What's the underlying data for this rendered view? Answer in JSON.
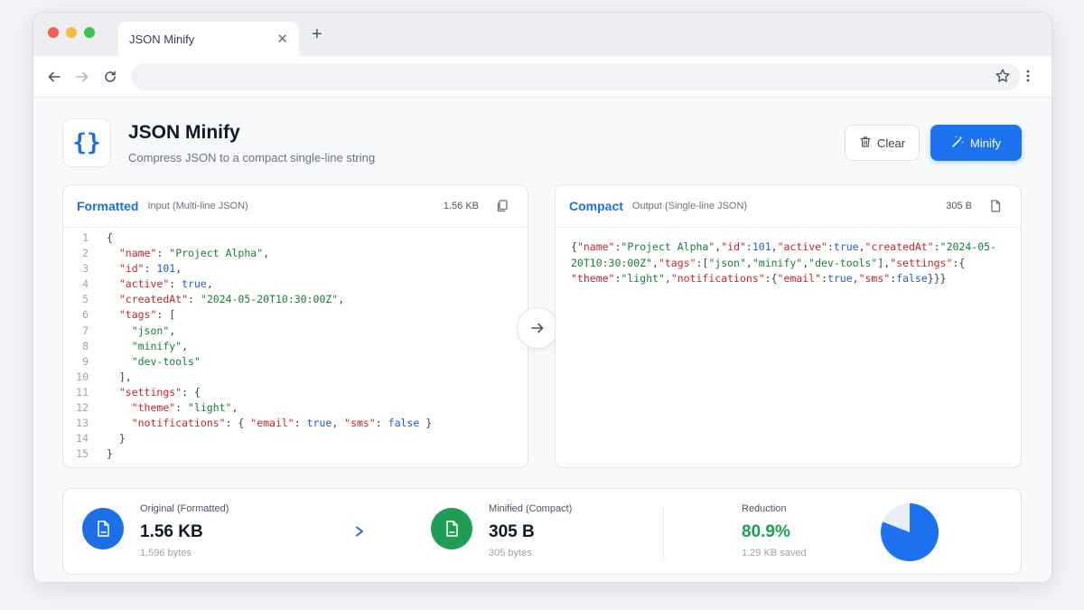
{
  "browser": {
    "tab_title": "JSON Minify",
    "close_glyph": "✕",
    "new_tab_glyph": "+"
  },
  "header": {
    "icon_text": "{}",
    "title": "JSON Minify",
    "subtitle": "Compress JSON to a compact single-line string",
    "clear_label": "Clear",
    "minify_label": "Minify"
  },
  "input_panel": {
    "name": "Formatted",
    "description": "Input (Multi-line JSON)",
    "size": "1.56 KB",
    "lines": [
      {
        "no": "1",
        "tokens": [
          {
            "t": "p",
            "v": "{"
          }
        ]
      },
      {
        "no": "2",
        "tokens": [
          {
            "t": "p",
            "v": "  "
          },
          {
            "t": "k",
            "v": "\"name\""
          },
          {
            "t": "p",
            "v": ": "
          },
          {
            "t": "s",
            "v": "\"Project Alpha\""
          },
          {
            "t": "p",
            "v": ","
          }
        ]
      },
      {
        "no": "3",
        "tokens": [
          {
            "t": "p",
            "v": "  "
          },
          {
            "t": "k",
            "v": "\"id\""
          },
          {
            "t": "p",
            "v": ": "
          },
          {
            "t": "n",
            "v": "101"
          },
          {
            "t": "p",
            "v": ","
          }
        ]
      },
      {
        "no": "4",
        "tokens": [
          {
            "t": "p",
            "v": "  "
          },
          {
            "t": "k",
            "v": "\"active\""
          },
          {
            "t": "p",
            "v": ": "
          },
          {
            "t": "b",
            "v": "true"
          },
          {
            "t": "p",
            "v": ","
          }
        ]
      },
      {
        "no": "5",
        "tokens": [
          {
            "t": "p",
            "v": "  "
          },
          {
            "t": "k",
            "v": "\"createdAt\""
          },
          {
            "t": "p",
            "v": ": "
          },
          {
            "t": "s",
            "v": "\"2024-05-20T10:30:00Z\""
          },
          {
            "t": "p",
            "v": ","
          }
        ]
      },
      {
        "no": "6",
        "tokens": [
          {
            "t": "p",
            "v": "  "
          },
          {
            "t": "k",
            "v": "\"tags\""
          },
          {
            "t": "p",
            "v": ": ["
          }
        ]
      },
      {
        "no": "7",
        "tokens": [
          {
            "t": "p",
            "v": "    "
          },
          {
            "t": "s",
            "v": "\"json\""
          },
          {
            "t": "p",
            "v": ","
          }
        ]
      },
      {
        "no": "8",
        "tokens": [
          {
            "t": "p",
            "v": "    "
          },
          {
            "t": "s",
            "v": "\"minify\""
          },
          {
            "t": "p",
            "v": ","
          }
        ]
      },
      {
        "no": "9",
        "tokens": [
          {
            "t": "p",
            "v": "    "
          },
          {
            "t": "s",
            "v": "\"dev-tools\""
          }
        ]
      },
      {
        "no": "10",
        "tokens": [
          {
            "t": "p",
            "v": "  ],"
          }
        ]
      },
      {
        "no": "11",
        "tokens": [
          {
            "t": "p",
            "v": "  "
          },
          {
            "t": "k",
            "v": "\"settings\""
          },
          {
            "t": "p",
            "v": ": {"
          }
        ]
      },
      {
        "no": "12",
        "tokens": [
          {
            "t": "p",
            "v": "    "
          },
          {
            "t": "k",
            "v": "\"theme\""
          },
          {
            "t": "p",
            "v": ": "
          },
          {
            "t": "s",
            "v": "\"light\""
          },
          {
            "t": "p",
            "v": ","
          }
        ]
      },
      {
        "no": "13",
        "tokens": [
          {
            "t": "p",
            "v": "    "
          },
          {
            "t": "k",
            "v": "\"notifications\""
          },
          {
            "t": "p",
            "v": ": { "
          },
          {
            "t": "k",
            "v": "\"email\""
          },
          {
            "t": "p",
            "v": ": "
          },
          {
            "t": "b",
            "v": "true"
          },
          {
            "t": "p",
            "v": ", "
          },
          {
            "t": "k",
            "v": "\"sms\""
          },
          {
            "t": "p",
            "v": ": "
          },
          {
            "t": "b",
            "v": "false"
          },
          {
            "t": "p",
            "v": " }"
          }
        ]
      },
      {
        "no": "14",
        "tokens": [
          {
            "t": "p",
            "v": "  }"
          }
        ]
      },
      {
        "no": "15",
        "tokens": [
          {
            "t": "p",
            "v": "}"
          }
        ]
      }
    ]
  },
  "output_panel": {
    "name": "Compact",
    "description": "Output (Single-line JSON)",
    "size": "305 B",
    "lines": [
      [
        {
          "t": "p",
          "v": "{"
        },
        {
          "t": "k",
          "v": "\"name\""
        },
        {
          "t": "p",
          "v": ":"
        },
        {
          "t": "s",
          "v": "\"Project Alpha\""
        },
        {
          "t": "p",
          "v": ","
        },
        {
          "t": "k",
          "v": "\"id\""
        },
        {
          "t": "p",
          "v": ":"
        },
        {
          "t": "n",
          "v": "101"
        },
        {
          "t": "p",
          "v": ","
        },
        {
          "t": "k",
          "v": "\"active\""
        },
        {
          "t": "p",
          "v": ":"
        },
        {
          "t": "b",
          "v": "true"
        },
        {
          "t": "p",
          "v": ","
        },
        {
          "t": "k",
          "v": "\"createdAt\""
        },
        {
          "t": "p",
          "v": ":"
        },
        {
          "t": "s",
          "v": "\"2024-05-"
        }
      ],
      [
        {
          "t": "s",
          "v": "20T10:30:00Z\""
        },
        {
          "t": "p",
          "v": ","
        },
        {
          "t": "k",
          "v": "\"tags\""
        },
        {
          "t": "p",
          "v": ":["
        },
        {
          "t": "s",
          "v": "\"json\""
        },
        {
          "t": "p",
          "v": ","
        },
        {
          "t": "s",
          "v": "\"minify\""
        },
        {
          "t": "p",
          "v": ","
        },
        {
          "t": "s",
          "v": "\"dev-tools\""
        },
        {
          "t": "p",
          "v": "],"
        },
        {
          "t": "k",
          "v": "\"settings\""
        },
        {
          "t": "p",
          "v": ":{"
        }
      ],
      [
        {
          "t": "k",
          "v": "\"theme\""
        },
        {
          "t": "p",
          "v": ":"
        },
        {
          "t": "s",
          "v": "\"light\""
        },
        {
          "t": "p",
          "v": ","
        },
        {
          "t": "k",
          "v": "\"notifications\""
        },
        {
          "t": "p",
          "v": ":{"
        },
        {
          "t": "k",
          "v": "\"email\""
        },
        {
          "t": "p",
          "v": ":"
        },
        {
          "t": "b",
          "v": "true"
        },
        {
          "t": "p",
          "v": ","
        },
        {
          "t": "k",
          "v": "\"sms\""
        },
        {
          "t": "p",
          "v": ":"
        },
        {
          "t": "b",
          "v": "false"
        },
        {
          "t": "p",
          "v": "}}}"
        }
      ]
    ]
  },
  "stats": {
    "original": {
      "label": "Original (Formatted)",
      "value": "1.56 KB",
      "sub": "1,596 bytes"
    },
    "minified": {
      "label": "Minified (Compact)",
      "value": "305 B",
      "sub": "305 bytes"
    },
    "reduction": {
      "label": "Reduction",
      "value": "80.9%",
      "sub": "1.29 KB saved",
      "fraction": 0.809
    }
  },
  "colors": {
    "accent": "#1d72f0",
    "key": "#c0262d",
    "string": "#177d3c",
    "number": "#1c5fcf",
    "success": "#1e9e57",
    "original_icon": "#1d6fe8",
    "minified_icon": "#1f9d55"
  },
  "icons": {
    "back": "arrow-left-icon",
    "forward": "arrow-right-icon",
    "reload": "reload-icon",
    "bookmark": "star-icon",
    "menu": "kebab-menu-icon",
    "clear": "trash-icon",
    "minify": "magic-wand-icon",
    "copy": "copy-icon",
    "convert": "arrow-right-icon",
    "file": "file-icon",
    "pie": "pie-chart-icon"
  }
}
